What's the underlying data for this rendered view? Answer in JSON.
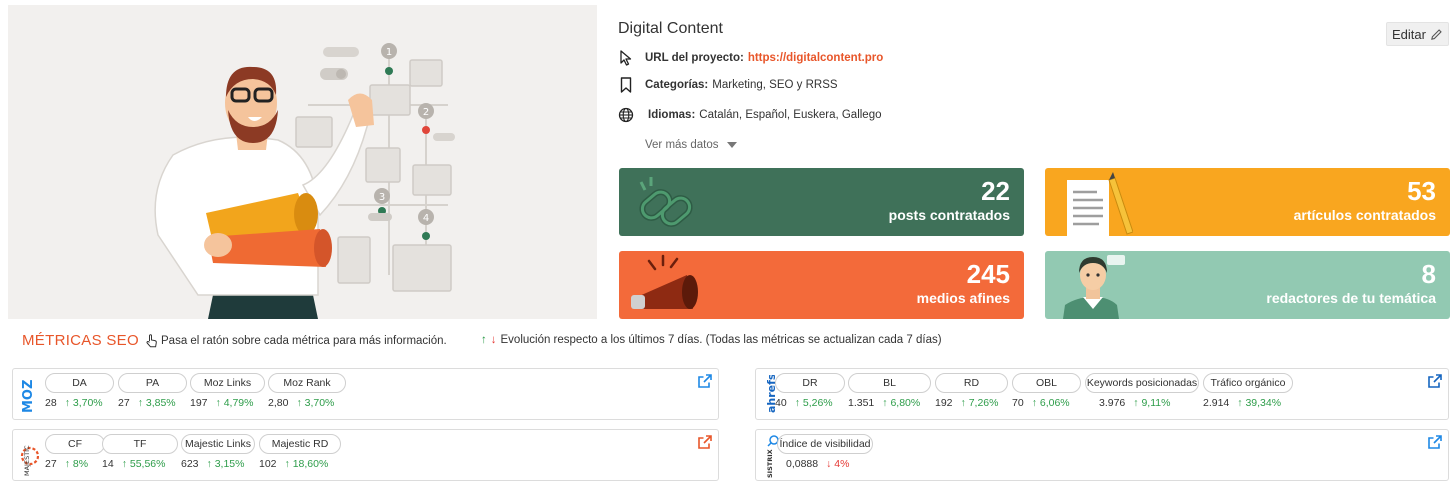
{
  "project": {
    "title": "Digital Content",
    "edit_label": "Editar",
    "url_label": "URL del proyecto:",
    "url": "https://digitalcontent.pro",
    "categories_label": "Categorías:",
    "categories": "Marketing, SEO y RRSS",
    "languages_label": "Idiomas:",
    "languages": "Catalán, Español, Euskera, Gallego",
    "more_label": "Ver más datos"
  },
  "cards": [
    {
      "value": "22",
      "label": "posts contratados",
      "color": "#3f7159"
    },
    {
      "value": "53",
      "label": "artículos contratados",
      "color": "#f9a61f"
    },
    {
      "value": "245",
      "label": "medios afines",
      "color": "#f36a3a"
    },
    {
      "value": "8",
      "label": "redactores de tu temática",
      "color": "#92c9b2"
    }
  ],
  "metrics_header": {
    "title": "MÉTRICAS SEO",
    "hint": "Pasa el ratón sobre cada métrica para más información.",
    "evolution_up": "↑",
    "evolution_down": "↓",
    "evolution": "Evolución respecto a los últimos 7 días. (Todas las métricas se actualizan cada 7 días)"
  },
  "moz": {
    "brand": "MOZ",
    "metrics": [
      {
        "name": "DA",
        "value": "28",
        "change": "↑ 3,70%",
        "trend": "up"
      },
      {
        "name": "PA",
        "value": "27",
        "change": "↑ 3,85%",
        "trend": "up"
      },
      {
        "name": "Moz Links",
        "value": "197",
        "change": "↑ 4,79%",
        "trend": "up"
      },
      {
        "name": "Moz Rank",
        "value": "2,80",
        "change": "↑ 3,70%",
        "trend": "up"
      }
    ]
  },
  "ahrefs": {
    "brand": "ahrefs",
    "metrics": [
      {
        "name": "DR",
        "value": "40",
        "change": "↑ 5,26%",
        "trend": "up"
      },
      {
        "name": "BL",
        "value": "1.351",
        "change": "↑ 6,80%",
        "trend": "up"
      },
      {
        "name": "RD",
        "value": "192",
        "change": "↑ 7,26%",
        "trend": "up"
      },
      {
        "name": "OBL",
        "value": "70",
        "change": "↑ 6,06%",
        "trend": "up"
      },
      {
        "name": "Keywords posicionadas",
        "value": "3.976",
        "change": "↑ 9,11%",
        "trend": "up"
      },
      {
        "name": "Tráfico orgánico",
        "value": "2.914",
        "change": "↑ 39,34%",
        "trend": "up"
      }
    ]
  },
  "majestic": {
    "brand": "MAJESTIC",
    "metrics": [
      {
        "name": "CF",
        "value": "27",
        "change": "↑ 8%",
        "trend": "up"
      },
      {
        "name": "TF",
        "value": "14",
        "change": "↑ 55,56%",
        "trend": "up"
      },
      {
        "name": "Majestic Links",
        "value": "623",
        "change": "↑ 3,15%",
        "trend": "up"
      },
      {
        "name": "Majestic RD",
        "value": "102",
        "change": "↑ 18,60%",
        "trend": "up"
      }
    ]
  },
  "sistrix": {
    "brand": "SISTRIX",
    "metrics": [
      {
        "name": "Índice de visibilidad",
        "value": "0,0888",
        "change": "↓ 4%",
        "trend": "down"
      }
    ]
  },
  "icons": {
    "url": "cursor-icon",
    "categories": "bookmark-icon",
    "languages": "globe-icon",
    "edit": "pencil-icon",
    "external": "external-link-icon"
  },
  "colors": {
    "accent": "#e8562a",
    "up": "#2e9d4a",
    "down": "#e53935",
    "link_blue": "#1e88e5"
  }
}
